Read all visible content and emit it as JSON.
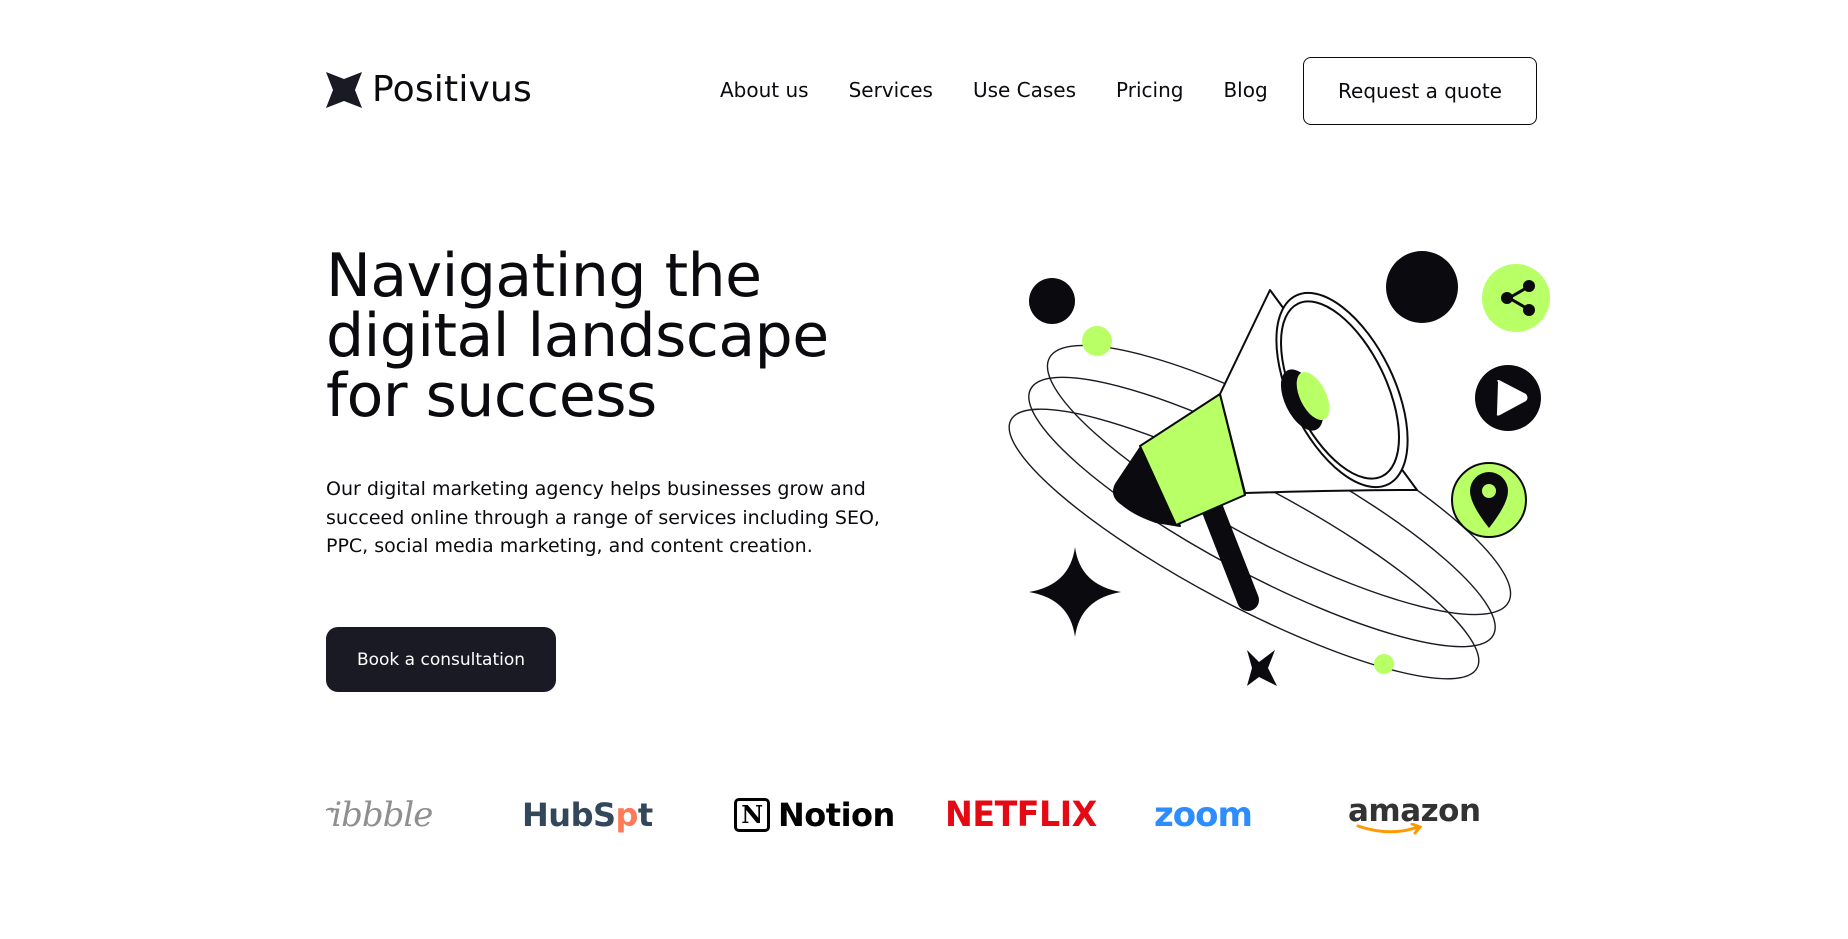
{
  "header": {
    "logo_text": "Positivus",
    "nav": [
      {
        "label": "About us"
      },
      {
        "label": "Services"
      },
      {
        "label": "Use Cases"
      },
      {
        "label": "Pricing"
      },
      {
        "label": "Blog"
      }
    ],
    "cta_label": "Request a quote"
  },
  "hero": {
    "title": "Navigating the digital landscape for success",
    "description": "Our digital marketing agency helps businesses grow and succeed online through a range of services including SEO, PPC, social media marketing, and content creation.",
    "cta_label": "Book a consultation",
    "illustration_icons": [
      "megaphone-icon",
      "share-icon",
      "play-icon",
      "location-pin-icon",
      "sparkle-star-icon"
    ]
  },
  "clients": {
    "dribbble": "ribbble",
    "hubspot_a": "HubS",
    "hubspot_b": "p",
    "hubspot_c": "t",
    "notion_mark": "N",
    "notion": "Notion",
    "netflix": "NETFLIX",
    "zoom": "zoom",
    "amazon": "amazon"
  },
  "colors": {
    "accent_green": "#B9FF66",
    "dark": "#191A23",
    "text": "#0B0B0F",
    "background": "#FFFFFF"
  }
}
